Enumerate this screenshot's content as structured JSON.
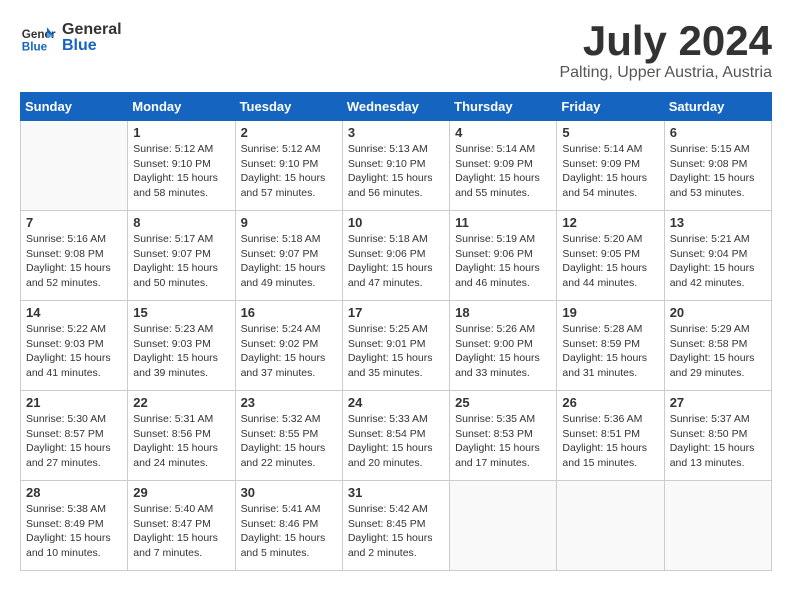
{
  "logo": {
    "line1": "General",
    "line2": "Blue"
  },
  "title": "July 2024",
  "location": "Palting, Upper Austria, Austria",
  "days_header": [
    "Sunday",
    "Monday",
    "Tuesday",
    "Wednesday",
    "Thursday",
    "Friday",
    "Saturday"
  ],
  "weeks": [
    [
      {
        "day": "",
        "info": ""
      },
      {
        "day": "1",
        "info": "Sunrise: 5:12 AM\nSunset: 9:10 PM\nDaylight: 15 hours\nand 58 minutes."
      },
      {
        "day": "2",
        "info": "Sunrise: 5:12 AM\nSunset: 9:10 PM\nDaylight: 15 hours\nand 57 minutes."
      },
      {
        "day": "3",
        "info": "Sunrise: 5:13 AM\nSunset: 9:10 PM\nDaylight: 15 hours\nand 56 minutes."
      },
      {
        "day": "4",
        "info": "Sunrise: 5:14 AM\nSunset: 9:09 PM\nDaylight: 15 hours\nand 55 minutes."
      },
      {
        "day": "5",
        "info": "Sunrise: 5:14 AM\nSunset: 9:09 PM\nDaylight: 15 hours\nand 54 minutes."
      },
      {
        "day": "6",
        "info": "Sunrise: 5:15 AM\nSunset: 9:08 PM\nDaylight: 15 hours\nand 53 minutes."
      }
    ],
    [
      {
        "day": "7",
        "info": "Sunrise: 5:16 AM\nSunset: 9:08 PM\nDaylight: 15 hours\nand 52 minutes."
      },
      {
        "day": "8",
        "info": "Sunrise: 5:17 AM\nSunset: 9:07 PM\nDaylight: 15 hours\nand 50 minutes."
      },
      {
        "day": "9",
        "info": "Sunrise: 5:18 AM\nSunset: 9:07 PM\nDaylight: 15 hours\nand 49 minutes."
      },
      {
        "day": "10",
        "info": "Sunrise: 5:18 AM\nSunset: 9:06 PM\nDaylight: 15 hours\nand 47 minutes."
      },
      {
        "day": "11",
        "info": "Sunrise: 5:19 AM\nSunset: 9:06 PM\nDaylight: 15 hours\nand 46 minutes."
      },
      {
        "day": "12",
        "info": "Sunrise: 5:20 AM\nSunset: 9:05 PM\nDaylight: 15 hours\nand 44 minutes."
      },
      {
        "day": "13",
        "info": "Sunrise: 5:21 AM\nSunset: 9:04 PM\nDaylight: 15 hours\nand 42 minutes."
      }
    ],
    [
      {
        "day": "14",
        "info": "Sunrise: 5:22 AM\nSunset: 9:03 PM\nDaylight: 15 hours\nand 41 minutes."
      },
      {
        "day": "15",
        "info": "Sunrise: 5:23 AM\nSunset: 9:03 PM\nDaylight: 15 hours\nand 39 minutes."
      },
      {
        "day": "16",
        "info": "Sunrise: 5:24 AM\nSunset: 9:02 PM\nDaylight: 15 hours\nand 37 minutes."
      },
      {
        "day": "17",
        "info": "Sunrise: 5:25 AM\nSunset: 9:01 PM\nDaylight: 15 hours\nand 35 minutes."
      },
      {
        "day": "18",
        "info": "Sunrise: 5:26 AM\nSunset: 9:00 PM\nDaylight: 15 hours\nand 33 minutes."
      },
      {
        "day": "19",
        "info": "Sunrise: 5:28 AM\nSunset: 8:59 PM\nDaylight: 15 hours\nand 31 minutes."
      },
      {
        "day": "20",
        "info": "Sunrise: 5:29 AM\nSunset: 8:58 PM\nDaylight: 15 hours\nand 29 minutes."
      }
    ],
    [
      {
        "day": "21",
        "info": "Sunrise: 5:30 AM\nSunset: 8:57 PM\nDaylight: 15 hours\nand 27 minutes."
      },
      {
        "day": "22",
        "info": "Sunrise: 5:31 AM\nSunset: 8:56 PM\nDaylight: 15 hours\nand 24 minutes."
      },
      {
        "day": "23",
        "info": "Sunrise: 5:32 AM\nSunset: 8:55 PM\nDaylight: 15 hours\nand 22 minutes."
      },
      {
        "day": "24",
        "info": "Sunrise: 5:33 AM\nSunset: 8:54 PM\nDaylight: 15 hours\nand 20 minutes."
      },
      {
        "day": "25",
        "info": "Sunrise: 5:35 AM\nSunset: 8:53 PM\nDaylight: 15 hours\nand 17 minutes."
      },
      {
        "day": "26",
        "info": "Sunrise: 5:36 AM\nSunset: 8:51 PM\nDaylight: 15 hours\nand 15 minutes."
      },
      {
        "day": "27",
        "info": "Sunrise: 5:37 AM\nSunset: 8:50 PM\nDaylight: 15 hours\nand 13 minutes."
      }
    ],
    [
      {
        "day": "28",
        "info": "Sunrise: 5:38 AM\nSunset: 8:49 PM\nDaylight: 15 hours\nand 10 minutes."
      },
      {
        "day": "29",
        "info": "Sunrise: 5:40 AM\nSunset: 8:47 PM\nDaylight: 15 hours\nand 7 minutes."
      },
      {
        "day": "30",
        "info": "Sunrise: 5:41 AM\nSunset: 8:46 PM\nDaylight: 15 hours\nand 5 minutes."
      },
      {
        "day": "31",
        "info": "Sunrise: 5:42 AM\nSunset: 8:45 PM\nDaylight: 15 hours\nand 2 minutes."
      },
      {
        "day": "",
        "info": ""
      },
      {
        "day": "",
        "info": ""
      },
      {
        "day": "",
        "info": ""
      }
    ]
  ]
}
